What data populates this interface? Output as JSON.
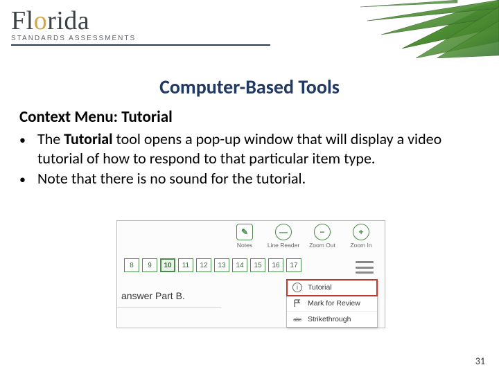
{
  "logo": {
    "line1_pre": "Fl",
    "line1_accent": "o",
    "line1_post": "rida",
    "line2": "Standards Assessments"
  },
  "title": "Computer-Based Tools",
  "subhead": "Context Menu: Tutorial",
  "bullets": [
    {
      "pre": "The ",
      "bold": "Tutorial",
      "post": " tool opens a pop-up window that will display a video tutorial of how to respond to that particular item type."
    },
    {
      "pre": "Note that there is no sound for the tutorial.",
      "bold": "",
      "post": ""
    }
  ],
  "inset": {
    "tools": [
      {
        "label": "Notes",
        "glyph": "✎"
      },
      {
        "label": "Line Reader",
        "glyph": "—"
      },
      {
        "label": "Zoom Out",
        "glyph": "−"
      },
      {
        "label": "Zoom In",
        "glyph": "+"
      }
    ],
    "questions": [
      "8",
      "9",
      "10",
      "11",
      "12",
      "13",
      "14",
      "15",
      "16",
      "17"
    ],
    "active_question_index": 2,
    "prompt_fragment": "answer Part B.",
    "context_menu": [
      {
        "label": "Tutorial",
        "icon": "info",
        "highlight": true
      },
      {
        "label": "Mark for Review",
        "icon": "flag",
        "highlight": false
      },
      {
        "label": "Strikethrough",
        "icon": "abc",
        "highlight": false
      }
    ]
  },
  "page_number": "31"
}
